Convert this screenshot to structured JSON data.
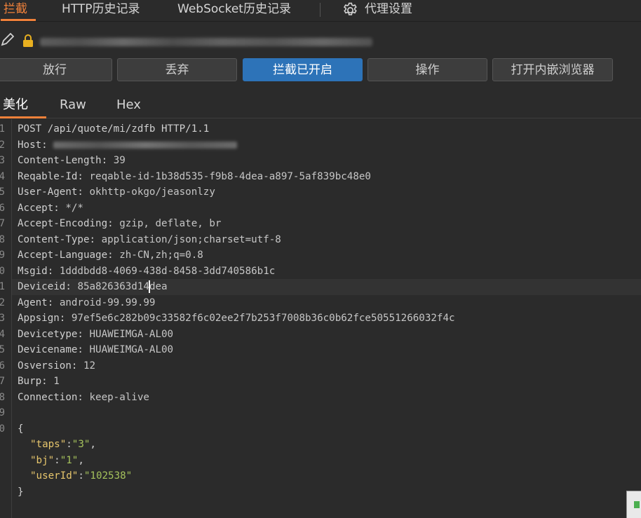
{
  "top_tabs": [
    {
      "label": "拦截",
      "active": true
    },
    {
      "label": "HTTP历史记录",
      "active": false
    },
    {
      "label": "WebSocket历史记录",
      "active": false
    }
  ],
  "settings_label": "代理设置",
  "url_bar": {
    "icon_pencil": "pencil-icon",
    "icon_lock": "lock-icon"
  },
  "buttons": {
    "forward": "放行",
    "drop": "丢弃",
    "intercept": "拦截已开启",
    "action": "操作",
    "browser": "打开内嵌浏览器"
  },
  "view_tabs": {
    "pretty": "美化",
    "raw": "Raw",
    "hex": "Hex"
  },
  "request": {
    "line1": "POST /api/quote/mi/zdfb HTTP/1.1",
    "host_key": "Host: ",
    "headers": [
      {
        "key": "Content-Length",
        "value": "39"
      },
      {
        "key": "Reqable-Id",
        "value": "reqable-id-1b38d535-f9b8-4dea-a897-5af839bc48e0"
      },
      {
        "key": "User-Agent",
        "value": "okhttp-okgo/jeasonlzy"
      },
      {
        "key": "Accept",
        "value": "*/*"
      },
      {
        "key": "Accept-Encoding",
        "value": "gzip, deflate, br"
      },
      {
        "key": "Content-Type",
        "value": "application/json;charset=utf-8"
      },
      {
        "key": "Accept-Language",
        "value": "zh-CN,zh;q=0.8"
      },
      {
        "key": "Msgid",
        "value": "1dddbdd8-4069-438d-8458-3dd740586b1c"
      }
    ],
    "deviceid_key": "Deviceid",
    "deviceid_before": "85a826363d14",
    "deviceid_after": "dea",
    "headers2": [
      {
        "key": "Agent",
        "value": "android-99.99.99"
      },
      {
        "key": "Appsign",
        "value": "97ef5e6c282b09c33582f6c02ee2f7b253f7008b36c0b62fce50551266032f4c"
      },
      {
        "key": "Devicetype",
        "value": "HUAWEIMGA-AL00"
      },
      {
        "key": "Devicename",
        "value": "HUAWEIMGA-AL00"
      },
      {
        "key": "Osversion",
        "value": "12"
      },
      {
        "key": "Burp",
        "value": "1"
      },
      {
        "key": "Connection",
        "value": "keep-alive"
      }
    ],
    "body_open": "{",
    "body": [
      {
        "k": "\"taps\"",
        "v": "\"3\"",
        "tail": ","
      },
      {
        "k": "\"bj\"",
        "v": "\"1\"",
        "tail": ","
      },
      {
        "k": "\"userId\"",
        "v": "\"102538\"",
        "tail": ""
      }
    ],
    "body_close": "}"
  },
  "line_numbers": [
    "1",
    "2",
    "3",
    "4",
    "5",
    "6",
    "7",
    "8",
    "9",
    "0",
    "1",
    "2",
    "3",
    "4",
    "5",
    "6",
    "7",
    "8",
    "9",
    "0"
  ]
}
